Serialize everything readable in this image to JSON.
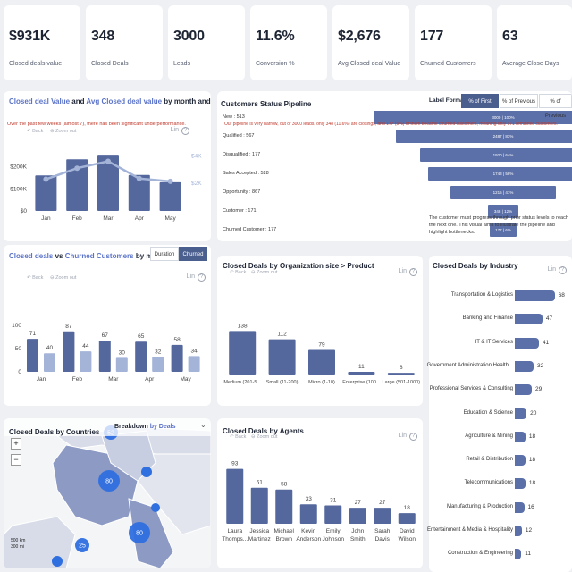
{
  "kpis": [
    {
      "value": "$931K",
      "label": "Closed deals value"
    },
    {
      "value": "348",
      "label": "Closed Deals"
    },
    {
      "value": "3000",
      "label": "Leads"
    },
    {
      "value": "11.6%",
      "label": "Conversion %"
    },
    {
      "value": "$2,676",
      "label": "Avg Closed deal Value"
    },
    {
      "value": "177",
      "label": "Churned Customers"
    },
    {
      "value": "63",
      "label": "Average Close Days"
    }
  ],
  "controls": {
    "back": "Back",
    "zoom_out": "Zoom out",
    "lin": "Lin",
    "help": "?"
  },
  "value_chart": {
    "title_a": "Closed deal Value",
    "title_and": " and ",
    "title_b": "Avg Closed deal value",
    "title_c": " by month and week",
    "subtitle": "Over the past few weeks (almost 7), there has been significant underperformance.",
    "chart_data": {
      "type": "bar",
      "categories": [
        "Jan",
        "Feb",
        "Mar",
        "Apr",
        "May"
      ],
      "series": [
        {
          "name": "Closed deal Value",
          "values": [
            161000,
            234000,
            255000,
            163000,
            130000
          ]
        },
        {
          "name": "Avg Closed deal value",
          "values": [
            2300,
            3100,
            3600,
            2350,
            2150
          ]
        }
      ],
      "y_ticks": [
        "$0",
        "$100K",
        "$200K"
      ],
      "y2_ticks": [
        "$2K",
        "$4K"
      ],
      "ylim": [
        0,
        300000
      ],
      "y2lim": [
        0,
        4800
      ],
      "colors": {
        "bar": "#55689d",
        "line": "#a4b4d8"
      }
    }
  },
  "pipeline": {
    "title": "Customers Status Pipeline",
    "label_format": "Label Format :",
    "formats": [
      "% of First",
      "% of Previous",
      "% of Previous"
    ],
    "overlay": "Our pipeline is very narrow, out of 3000 leads, only 348 (11.6%) are closings, and 177 (5%) of them became churned customers, meaning only 171 remained customers.",
    "note": "The customer must progress through prior status levels to reach the next one. This visual aims to illustrate the pipeline and highlight bottlenecks.",
    "chart_data": {
      "type": "bar",
      "stages": [
        {
          "label": "New : 513",
          "count": 3000,
          "bar_label": "3000 | 100%"
        },
        {
          "label": "Qualified : 567",
          "count": 2487,
          "bar_label": "2487 | 83%"
        },
        {
          "label": "Disqualified : 177",
          "count": 1920,
          "bar_label": "1920 | 64%"
        },
        {
          "label": "Sales Accepted : 528",
          "count": 1743,
          "bar_label": "1743 | 58%"
        },
        {
          "label": "Opportunity : 867",
          "count": 1215,
          "bar_label": "1215 | 41%"
        },
        {
          "label": "Customer : 171",
          "count": 348,
          "bar_label": "348 | 12%"
        },
        {
          "label": "Churned Customer : 177",
          "count": 177,
          "bar_label": "177 | 6%"
        }
      ]
    }
  },
  "churn_chart": {
    "title_a": "Closed deals",
    "title_vs": " vs ",
    "title_b": "Churned Customers",
    "title_c": " by month & week",
    "toggle": [
      "Duration",
      "Churned"
    ],
    "chart_data": {
      "type": "bar",
      "categories": [
        "Jan",
        "Feb",
        "Mar",
        "Apr",
        "May"
      ],
      "series": [
        {
          "name": "Closed deals",
          "values": [
            71,
            87,
            67,
            65,
            58
          ]
        },
        {
          "name": "Churned Customers",
          "values": [
            40,
            44,
            30,
            32,
            34
          ]
        }
      ],
      "y_ticks": [
        "0",
        "50",
        "100"
      ],
      "ylim": [
        0,
        100
      ],
      "colors": {
        "a": "#55689d",
        "b": "#a4b4d8"
      }
    }
  },
  "org_chart": {
    "title": "Closed Deals by Organization size > Product",
    "chart_data": {
      "type": "bar",
      "categories": [
        "Medium (201-5...",
        "Small (11-200)",
        "Micro (1-10)",
        "Enterprise (100...",
        "Large (501-1000)"
      ],
      "values": [
        138,
        112,
        79,
        11,
        8
      ],
      "ylim": [
        0,
        150
      ]
    }
  },
  "industry_chart": {
    "title": "Closed Deals by Industry",
    "chart_data": {
      "type": "bar",
      "categories": [
        "Transportation & Logistics",
        "Banking and Finance",
        "IT & IT Services",
        "Government Administration Health...",
        "Professional Services & Consulting",
        "Education & Science",
        "Agriculture & Mining",
        "Retail & Distribution",
        "Telecommunications",
        "Manufacturing & Production",
        "Entertainment & Media & Hospitality",
        "Construction & Engineering"
      ],
      "values": [
        68,
        47,
        41,
        32,
        29,
        20,
        18,
        18,
        18,
        16,
        12,
        11
      ],
      "xlim": [
        0,
        70
      ]
    }
  },
  "map_panel": {
    "title": "Closed Deals by Countries",
    "breakdown_a": "Breakdown ",
    "breakdown_b": "by Deals",
    "zoom_in": "+",
    "zoom_out": "−",
    "scale_km": "500 km",
    "scale_mi": "300 mi",
    "chart_data": {
      "type": "scatter",
      "bubbles": [
        80,
        80,
        25,
        52
      ]
    }
  },
  "agents_chart": {
    "title": "Closed Deals by Agents",
    "chart_data": {
      "type": "bar",
      "categories": [
        [
          "Laura",
          "Thomps..."
        ],
        [
          "Jessica",
          "Martinez"
        ],
        [
          "Michael",
          "Brown"
        ],
        [
          "Kevin",
          "Anderson"
        ],
        [
          "Emily",
          "Johnson"
        ],
        [
          "John",
          "Smith"
        ],
        [
          "Sarah",
          "Davis"
        ],
        [
          "David",
          "Wilson"
        ]
      ],
      "values": [
        93,
        61,
        58,
        33,
        31,
        27,
        27,
        18
      ],
      "ylim": [
        0,
        100
      ]
    }
  }
}
